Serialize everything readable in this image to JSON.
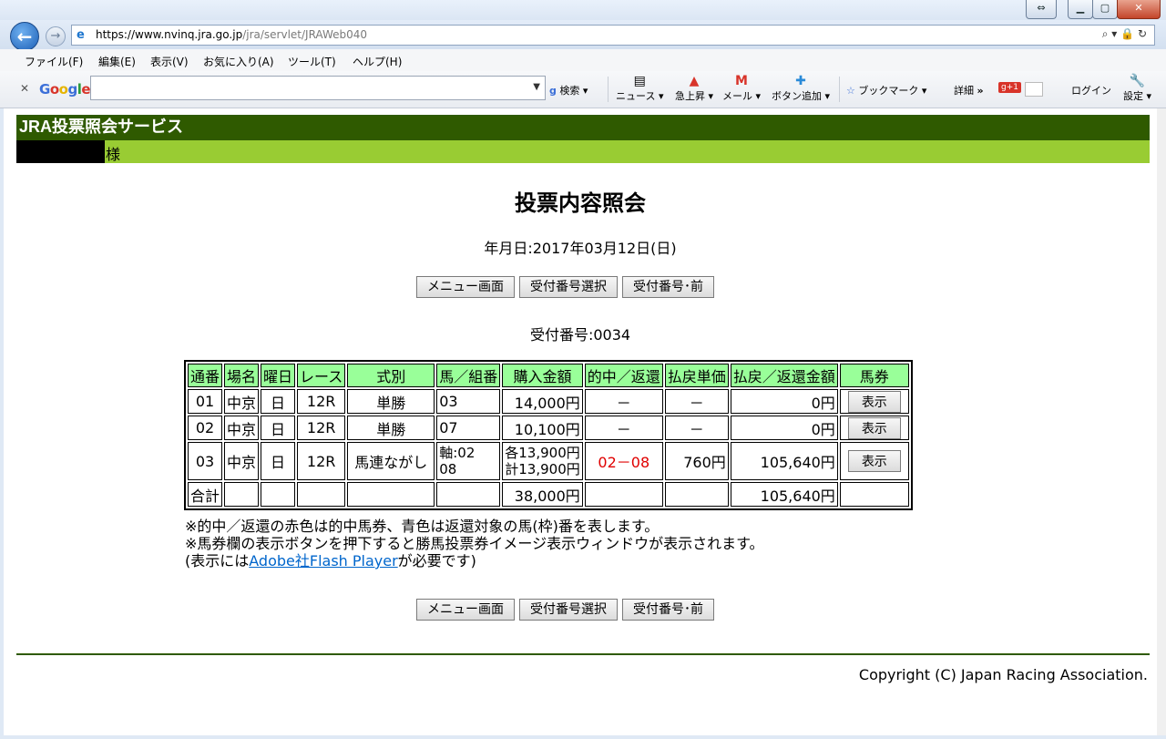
{
  "browser": {
    "url_host": "https://www.nvinq.jra.go.jp",
    "url_path": "/jra/servlet/JRAWeb040",
    "menu": [
      "ファイル(F)",
      "編集(E)",
      "表示(V)",
      "お気に入り(A)",
      "ツール(T)",
      "ヘルプ(H)"
    ],
    "toolbar": {
      "search_label": "検索",
      "news_label": "ニュース",
      "trending_label": "急上昇",
      "mail_label": "メール",
      "add_button_label": "ボタン追加",
      "bookmark_label": "ブックマーク",
      "details_label": "詳細",
      "more_label": "»",
      "login_label": "ログイン",
      "settings_label": "設定"
    }
  },
  "site": {
    "service_name": "JRA投票照会サービス",
    "honorific": "様"
  },
  "page": {
    "title": "投票内容照会",
    "date_line": "年月日:2017年03月12日(日)",
    "buttons": [
      "メニュー画面",
      "受付番号選択",
      "受付番号･前"
    ],
    "receipt_line": "受付番号:0034"
  },
  "table": {
    "headers": [
      "通番",
      "場名",
      "曜日",
      "レース",
      "式別",
      "馬／組番",
      "購入金額",
      "的中／返還",
      "払戻単価",
      "払戻／返還金額",
      "馬券"
    ],
    "rows": [
      {
        "no": "01",
        "venue": "中京",
        "day": "日",
        "race": "12R",
        "type": "単勝",
        "combo": [
          "03"
        ],
        "amount": [
          "14,000円"
        ],
        "hit": "－",
        "unit": "－",
        "payout": "0円",
        "ticket_btn": "表示"
      },
      {
        "no": "02",
        "venue": "中京",
        "day": "日",
        "race": "12R",
        "type": "単勝",
        "combo": [
          "07"
        ],
        "amount": [
          "10,100円"
        ],
        "hit": "－",
        "unit": "－",
        "payout": "0円",
        "ticket_btn": "表示"
      },
      {
        "no": "03",
        "venue": "中京",
        "day": "日",
        "race": "12R",
        "type": "馬連ながし",
        "combo": [
          "軸:02",
          "08"
        ],
        "amount": [
          "各13,900円",
          "計13,900円"
        ],
        "hit": "02－08",
        "unit": "760円",
        "payout": "105,640円",
        "ticket_btn": "表示"
      }
    ],
    "total": {
      "label": "合計",
      "amount": "38,000円",
      "payout": "105,640円"
    }
  },
  "notes": {
    "line1": "※的中／返還の赤色は的中馬券、青色は返還対象の馬(枠)番を表します。",
    "line2": "※馬券欄の表示ボタンを押下すると勝馬投票券イメージ表示ウィンドウが表示されます。",
    "line3_prefix": "(表示には",
    "line3_link": "Adobe社Flash Player",
    "line3_suffix": "が必要です)"
  },
  "footer": {
    "copyright": "Copyright (C) Japan Racing Association."
  },
  "colors": {
    "header_dark": "#2f5a00",
    "header_light": "#99cc33",
    "table_header": "#99ff99",
    "hit_red": "#e00000",
    "link_blue": "#0066cc"
  }
}
